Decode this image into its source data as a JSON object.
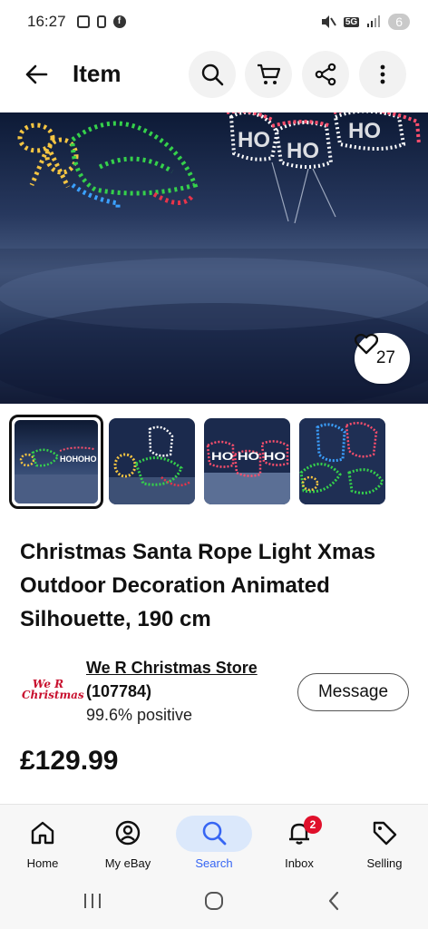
{
  "status_bar": {
    "time": "16:27",
    "network": "5G",
    "battery": "6"
  },
  "app_bar": {
    "title": "Item"
  },
  "hero": {
    "like_count": "27",
    "hero_text": "HO HO HO"
  },
  "thumbnails": [
    {
      "label": "HOHOHO"
    },
    {
      "label": ""
    },
    {
      "label": "HO HO HO"
    },
    {
      "label": ""
    }
  ],
  "product": {
    "title": "Christmas Santa Rope Light Xmas Outdoor Decoration Animated Silhouette, 190 cm",
    "price": "£129.99"
  },
  "seller": {
    "logo_text_1": "We R",
    "logo_text_2": "Christmas",
    "name": "We R Christmas Store",
    "feedback": "(107784)",
    "positive": "99.6% positive",
    "message_label": "Message"
  },
  "bottom_nav": [
    {
      "label": "Home"
    },
    {
      "label": "My eBay"
    },
    {
      "label": "Search"
    },
    {
      "label": "Inbox",
      "badge": "2"
    },
    {
      "label": "Selling"
    }
  ],
  "colors": {
    "accent": "#3665f3",
    "badge": "#e0102b",
    "active_pill": "#dbe8fb",
    "brand_red": "#c8102e"
  }
}
